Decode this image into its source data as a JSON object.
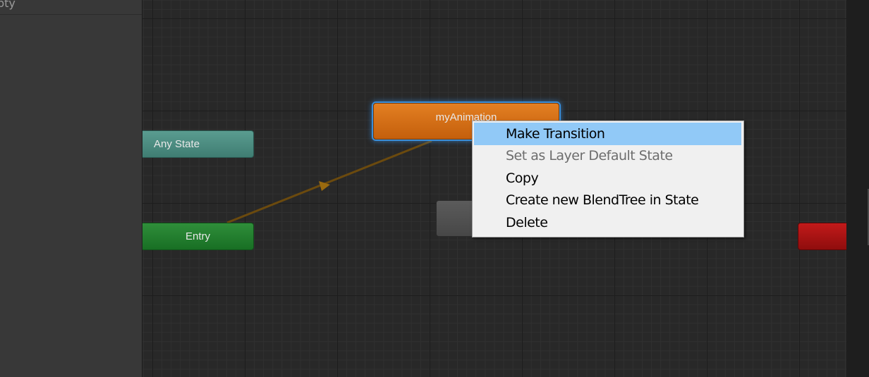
{
  "left_panel": {
    "partial_label": "pty"
  },
  "states": {
    "any_state": "Any State",
    "entry": "Entry",
    "animation": "myAnimation"
  },
  "context_menu": {
    "items": [
      {
        "label": "Make Transition",
        "highlighted": true,
        "disabled": false
      },
      {
        "label": "Set as Layer Default State",
        "highlighted": false,
        "disabled": true
      },
      {
        "label": "Copy",
        "highlighted": false,
        "disabled": false
      },
      {
        "label": "Create new BlendTree in State",
        "highlighted": false,
        "disabled": false
      },
      {
        "label": "Delete",
        "highlighted": false,
        "disabled": false
      }
    ]
  },
  "colors": {
    "any_state": "#4f8f84",
    "entry": "#237f2f",
    "animation_default": "#d46d17",
    "exit": "#a81414",
    "selection_glow": "#3b8ed8",
    "menu_highlight": "#91c9f7",
    "transition_line": "#6b4a0e"
  }
}
